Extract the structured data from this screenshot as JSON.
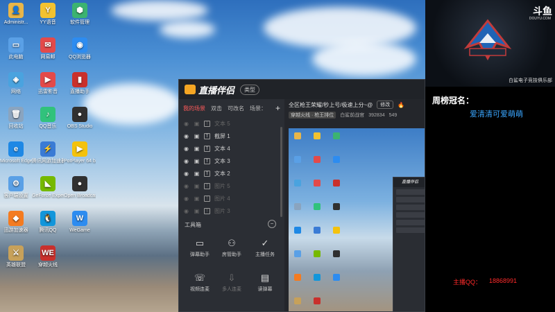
{
  "desktop": {
    "icons": [
      {
        "label": "Administr...",
        "color": "#e8b64a",
        "glyph": "👤"
      },
      {
        "label": "YY语音",
        "color": "#f2c230",
        "glyph": "Y"
      },
      {
        "label": "软件管理",
        "color": "#3cb371",
        "glyph": "⬢"
      },
      {
        "label": "此电脑",
        "color": "#5aa0e6",
        "glyph": "▭"
      },
      {
        "label": "网易邮",
        "color": "#e34a4a",
        "glyph": "✉"
      },
      {
        "label": "QQ浏览器",
        "color": "#2d8cf0",
        "glyph": "◉"
      },
      {
        "label": "网络",
        "color": "#4aa3df",
        "glyph": "◈"
      },
      {
        "label": "迅雷影音",
        "color": "#e34a4a",
        "glyph": "▶"
      },
      {
        "label": "直播助手",
        "color": "#c9302c",
        "glyph": "▮"
      },
      {
        "label": "回收站",
        "color": "#8aa4bf",
        "glyph": "🗑"
      },
      {
        "label": "QQ音乐",
        "color": "#31c27c",
        "glyph": "♪"
      },
      {
        "label": "OBS Studio",
        "color": "#303030",
        "glyph": "●"
      },
      {
        "label": "Microsoft Edge",
        "color": "#1e88e5",
        "glyph": "e"
      },
      {
        "label": "腾讯网游加速器",
        "color": "#3a7bd5",
        "glyph": "⚡"
      },
      {
        "label": "PotPlayer 64 bit",
        "color": "#f4c20d",
        "glyph": "▶"
      },
      {
        "label": "客户端设置",
        "color": "#5aa0e6",
        "glyph": "⚙"
      },
      {
        "label": "GeForce Experience",
        "color": "#76b900",
        "glyph": "◣"
      },
      {
        "label": "Open Broadcast...",
        "color": "#303030",
        "glyph": "●"
      },
      {
        "label": "迅游加速器",
        "color": "#f47b20",
        "glyph": "◆"
      },
      {
        "label": "腾讯QQ",
        "color": "#1296db",
        "glyph": "🐧"
      },
      {
        "label": "WeGame",
        "color": "#2d8cf0",
        "glyph": "W"
      },
      {
        "label": "英雄联盟",
        "color": "#c7a15a",
        "glyph": "⚔"
      },
      {
        "label": "穿越火线",
        "color": "#c9302c",
        "glyph": "WE"
      }
    ]
  },
  "app": {
    "title": "直播伴侣",
    "badge": "类型",
    "tabs": [
      "我的场景",
      "双击",
      "可改名",
      "场景："
    ],
    "plus": "+",
    "layers": [
      {
        "name": "文本 5",
        "dim": true
      },
      {
        "name": "截屏 1",
        "dim": false
      },
      {
        "name": "文本 4",
        "dim": false
      },
      {
        "name": "文本 3",
        "dim": false
      },
      {
        "name": "文本 2",
        "dim": false
      },
      {
        "name": "图片 5",
        "dim": true
      },
      {
        "name": "图片 4",
        "dim": true
      },
      {
        "name": "图片 3",
        "dim": true
      }
    ],
    "toolbox_title": "工具箱",
    "tools": [
      {
        "label": "弹幕助手",
        "glyph": "▭"
      },
      {
        "label": "房管助手",
        "glyph": "⚇"
      },
      {
        "label": "主播任务",
        "glyph": "✓"
      },
      {
        "label": "视频连麦",
        "glyph": "☏"
      },
      {
        "label": "多人连麦",
        "glyph": "⇩"
      },
      {
        "label": "读弹幕",
        "glyph": "▤"
      }
    ],
    "preview": {
      "room_title": "全区枪王荣耀/秒上号/极速上分~@",
      "edit_label": "修改",
      "sub_tag": "穿越火线 · 枪王排位",
      "category": "白鲨前战官",
      "viewers": "392834",
      "extra": "549"
    },
    "nested_title": "直播伴侣"
  },
  "overlay": {
    "platform": "斗鱼",
    "platform_sub": "DOUYU.COM",
    "cam_caption": "白鲨电子竞技俱乐部",
    "weekly_label": "周榜冠名：",
    "weekly_name": "爱清清可爱萌萌",
    "qq_label": "主播QQ：",
    "qq_number": "18868991"
  }
}
